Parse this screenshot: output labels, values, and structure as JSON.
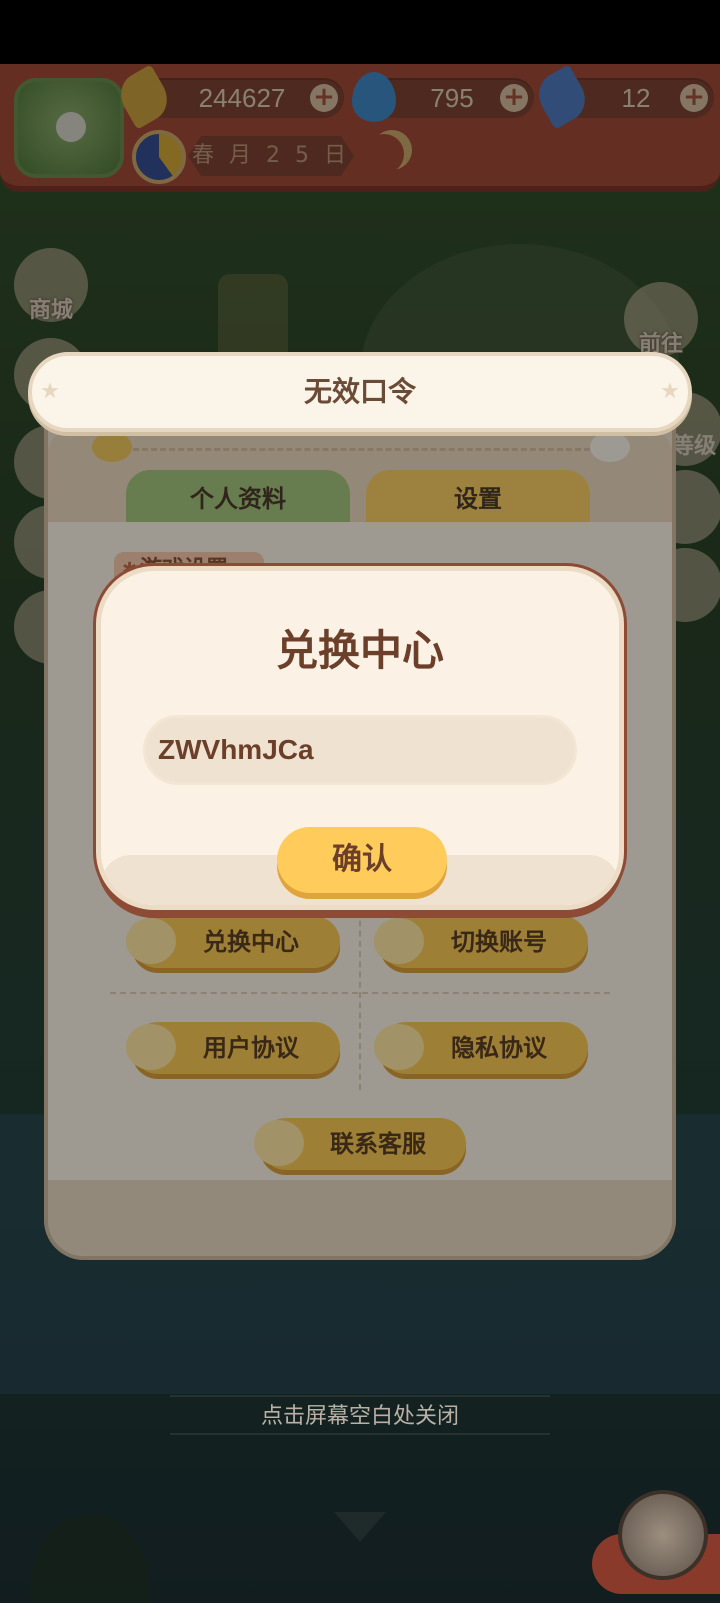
{
  "hud": {
    "bananas": "244627",
    "gems": "795",
    "tickets": "12",
    "date": "春 月 2 5 日"
  },
  "side_buttons": {
    "shop": "商城",
    "goto": "前往",
    "level_partial": "等级"
  },
  "panel": {
    "tab_profile": "个人资料",
    "tab_settings": "设置",
    "section": "游戏设置",
    "redeem_center": "兑换中心",
    "switch_account": "切换账号",
    "user_agreement": "用户协议",
    "privacy_agreement": "隐私协议",
    "contact_support": "联系客服"
  },
  "toast": {
    "message": "无效口令"
  },
  "dialog": {
    "title": "兑换中心",
    "input_value": "ZWVhmJCa",
    "confirm": "确认"
  },
  "close_hint": "点击屏幕空白处关闭",
  "colors": {
    "hud_bg": "#b8543e",
    "accent_yellow": "#ffcb5a",
    "dialog_bg": "#fbf2e5",
    "text_brown": "#6b3f2a"
  },
  "icons": [
    "banana-icon",
    "fire-icon",
    "ticket-icon",
    "clock-icon",
    "moon-icon",
    "star-icon",
    "paw-icon",
    "collapse-icon",
    "yarn-icon"
  ]
}
